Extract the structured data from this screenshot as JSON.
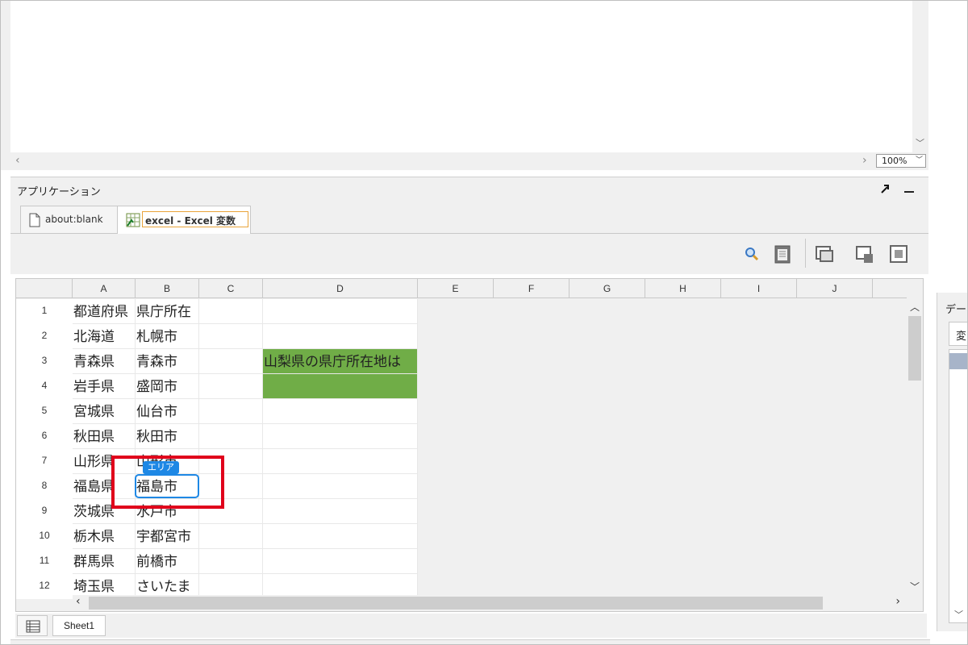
{
  "zoom": {
    "value": "100%"
  },
  "panel": {
    "title": "アプリケーション"
  },
  "tabs": [
    {
      "label": "about:blank"
    },
    {
      "label": "excel - Excel 変数"
    }
  ],
  "sheet": {
    "columns": [
      "A",
      "B",
      "C",
      "D",
      "E",
      "F",
      "G",
      "H",
      "I",
      "J"
    ],
    "rows": [
      {
        "num": "1",
        "a": "都道府県",
        "b": "県庁所在",
        "c": "",
        "d": ""
      },
      {
        "num": "2",
        "a": "北海道",
        "b": "札幌市",
        "c": "",
        "d": ""
      },
      {
        "num": "3",
        "a": "青森県",
        "b": "青森市",
        "c": "",
        "d": "山梨県の県庁所在地は"
      },
      {
        "num": "4",
        "a": "岩手県",
        "b": "盛岡市",
        "c": "",
        "d": ""
      },
      {
        "num": "5",
        "a": "宮城県",
        "b": "仙台市",
        "c": "",
        "d": ""
      },
      {
        "num": "6",
        "a": "秋田県",
        "b": "秋田市",
        "c": "",
        "d": ""
      },
      {
        "num": "7",
        "a": "山形県",
        "b": "山形市",
        "c": "",
        "d": ""
      },
      {
        "num": "8",
        "a": "福島県",
        "b": "福島市",
        "c": "",
        "d": ""
      },
      {
        "num": "9",
        "a": "茨城県",
        "b": "水戸市",
        "c": "",
        "d": ""
      },
      {
        "num": "10",
        "a": "栃木県",
        "b": "宇都宮市",
        "c": "",
        "d": ""
      },
      {
        "num": "11",
        "a": "群馬県",
        "b": "前橋市",
        "c": "",
        "d": ""
      },
      {
        "num": "12",
        "a": "埼玉県",
        "b": "さいたま",
        "c": "",
        "d": ""
      }
    ],
    "highlight_fill": "#70ad47",
    "area_tag": "エリア",
    "sheet_tab": "Sheet1"
  },
  "right_panel": {
    "label": "デー",
    "tab": "変"
  },
  "colors": {
    "area_blue": "#1e88e5",
    "annotation_red": "#e0001b"
  }
}
